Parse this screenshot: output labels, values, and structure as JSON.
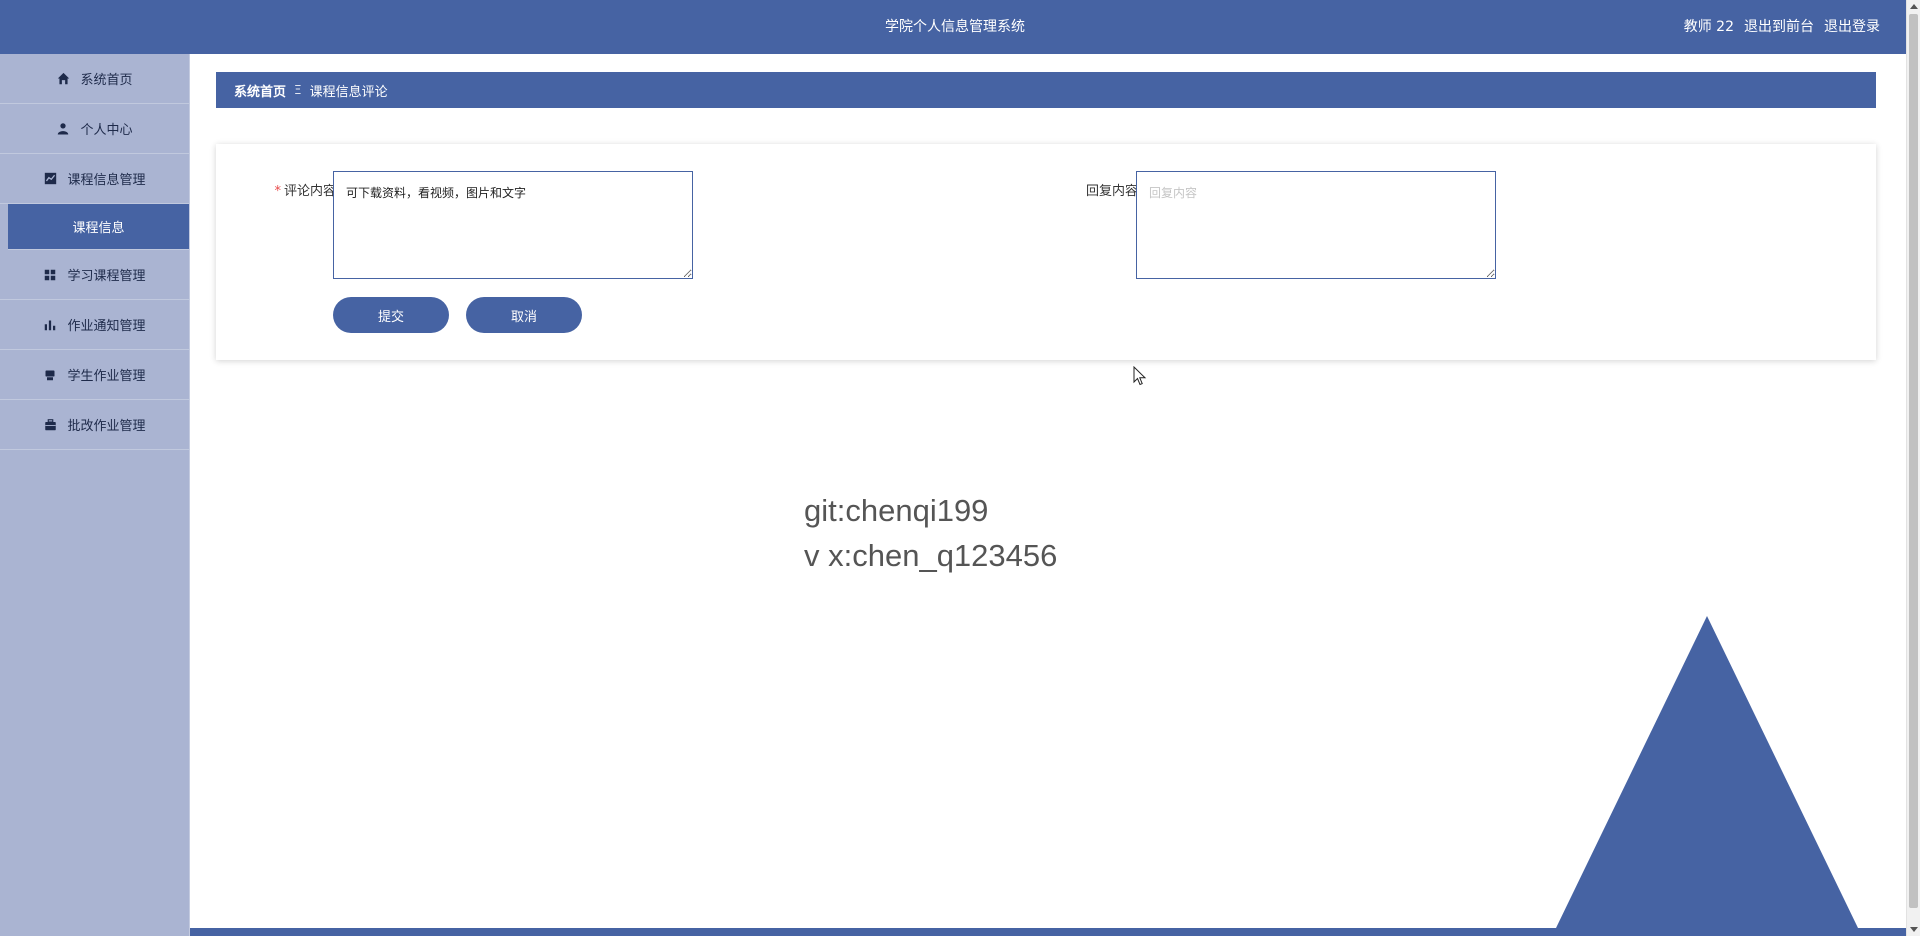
{
  "header": {
    "title": "学院个人信息管理系统",
    "user": "教师 22",
    "to_front": "退出到前台",
    "logout": "退出登录"
  },
  "sidebar": {
    "items": [
      {
        "label": "系统首页",
        "icon": "home-icon"
      },
      {
        "label": "个人中心",
        "icon": "user-icon"
      },
      {
        "label": "课程信息管理",
        "icon": "chart-line-icon"
      },
      {
        "label": "学习课程管理",
        "icon": "grid-icon"
      },
      {
        "label": "作业通知管理",
        "icon": "bar-chart-icon"
      },
      {
        "label": "学生作业管理",
        "icon": "printer-icon"
      },
      {
        "label": "批改作业管理",
        "icon": "briefcase-icon"
      }
    ],
    "active_sub": "课程信息"
  },
  "breadcrumb": {
    "home": "系统首页",
    "separator": "Ξ",
    "current": "课程信息评论"
  },
  "form": {
    "comment_label": "评论内容",
    "comment_required_mark": "*",
    "comment_value": "可下载资料，看视频，图片和文字",
    "reply_label": "回复内容",
    "reply_placeholder": "回复内容",
    "submit_label": "提交",
    "cancel_label": "取消"
  },
  "watermark": {
    "line1": "git:chenqi199",
    "line2": "v x:chen_q123456"
  },
  "colors": {
    "primary": "#4663a3",
    "sidebar_bg": "#aab4d2"
  }
}
